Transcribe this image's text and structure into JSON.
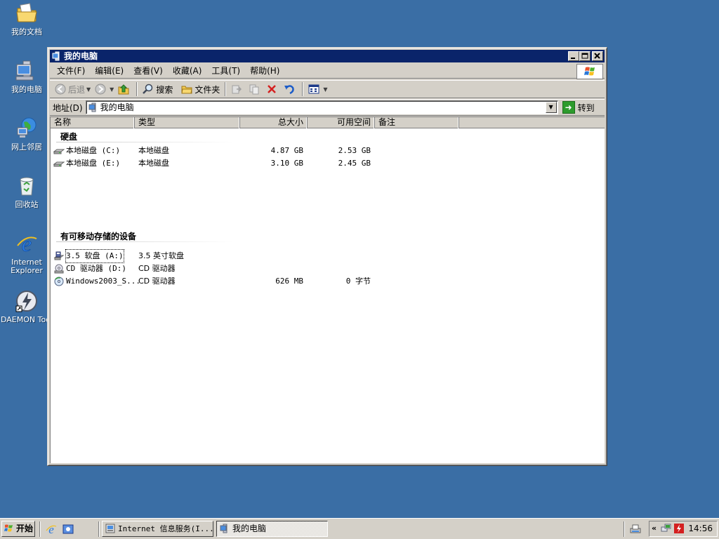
{
  "desktop": {
    "icons": [
      {
        "label": "我的文档",
        "icon": "my-documents-icon"
      },
      {
        "label": "我的电脑",
        "icon": "my-computer-icon"
      },
      {
        "label": "网上邻居",
        "icon": "network-places-icon"
      },
      {
        "label": "回收站",
        "icon": "recycle-bin-icon"
      },
      {
        "label": "Internet\nExplorer",
        "icon": "internet-explorer-icon"
      },
      {
        "label": "DAEMON Tool",
        "icon": "daemon-tools-icon"
      }
    ]
  },
  "window": {
    "title": "我的电脑",
    "controls": {
      "minimize": "minimize-icon",
      "maximize": "maximize-icon",
      "close": "close-icon"
    },
    "menu": [
      "文件(F)",
      "编辑(E)",
      "查看(V)",
      "收藏(A)",
      "工具(T)",
      "帮助(H)"
    ],
    "toolbar": {
      "back": "后退",
      "search": "搜索",
      "folders": "文件夹"
    },
    "address": {
      "label": "地址(D)",
      "value": "我的电脑",
      "go": "转到"
    },
    "columns": {
      "name": "名称",
      "type": "类型",
      "total": "总大小",
      "free": "可用空间",
      "comment": "备注"
    },
    "groups": [
      {
        "title": "硬盘",
        "items": [
          {
            "name": "本地磁盘 (C:)",
            "type": "本地磁盘",
            "total": "4.87 GB",
            "free": "2.53 GB",
            "icon": "hard-disk-icon"
          },
          {
            "name": "本地磁盘 (E:)",
            "type": "本地磁盘",
            "total": "3.10 GB",
            "free": "2.45 GB",
            "icon": "hard-disk-icon"
          }
        ]
      },
      {
        "title": "有可移动存储的设备",
        "items": [
          {
            "name": "3.5 软盘 (A:)",
            "type": "3.5 英寸软盘",
            "total": "",
            "free": "",
            "icon": "floppy-icon"
          },
          {
            "name": "CD 驱动器 (D:)",
            "type": "CD 驱动器",
            "total": "",
            "free": "",
            "icon": "cd-drive-icon"
          },
          {
            "name": "Windows2003_S...",
            "type": "CD 驱动器",
            "total": "626 MB",
            "free": "0 字节",
            "icon": "cd-drive-icon"
          }
        ]
      }
    ]
  },
  "taskbar": {
    "start": "开始",
    "tasks": [
      {
        "label": "Internet 信息服务(I...",
        "active": false
      },
      {
        "label": "我的电脑",
        "active": true
      }
    ],
    "clock": "14:56"
  },
  "colors": {
    "desktop": "#3a6ea5",
    "titlebar": "#0a246a",
    "face": "#d4d0c8"
  }
}
